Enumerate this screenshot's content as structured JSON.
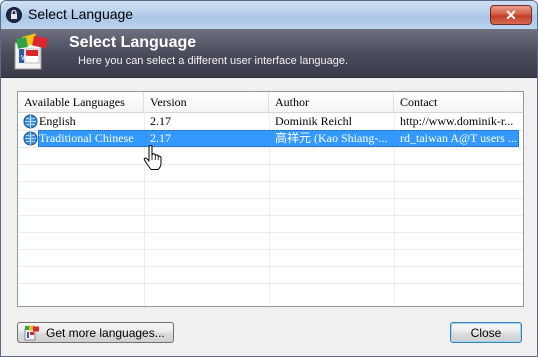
{
  "window": {
    "title": "Select Language"
  },
  "banner": {
    "title": "Select Language",
    "subtitle": "Here you can select a different user interface language."
  },
  "list": {
    "columns": [
      "Available Languages",
      "Version",
      "Author",
      "Contact"
    ],
    "rows": [
      {
        "language": "English",
        "version": "2.17",
        "author": "Dominik Reichl",
        "contact": "http://www.dominik-r...",
        "selected": false
      },
      {
        "language": "Traditional Chinese",
        "version": "2.17",
        "author": "高祥元 (Kao Shiang-...",
        "contact": "rd_taiwan A@T users ...",
        "selected": true
      }
    ]
  },
  "buttons": {
    "get_more": "Get more languages...",
    "close": "Close"
  },
  "colors": {
    "selection": "#3399ff",
    "banner": "#4b4c5c"
  }
}
